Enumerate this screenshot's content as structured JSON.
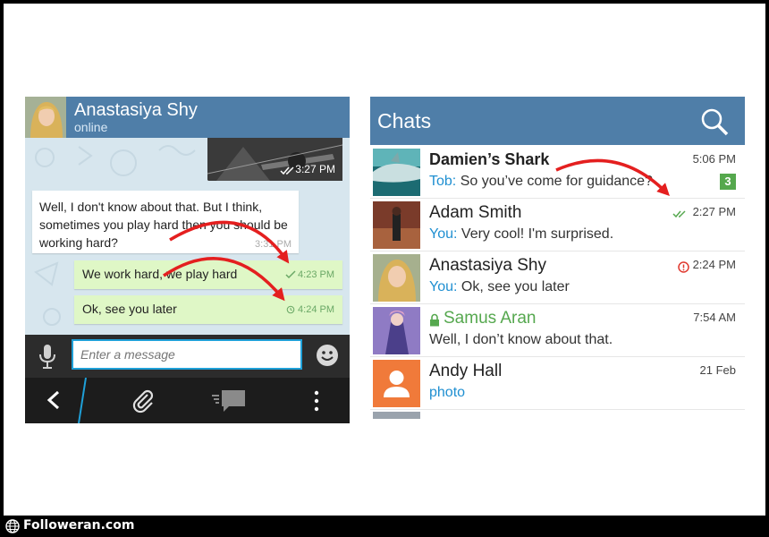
{
  "footer": {
    "brand": "Followeran.com"
  },
  "conversation": {
    "contact_name": "Anastasiya Shy",
    "contact_status": "online",
    "photo_message_time": "3:27 PM",
    "incoming_message": {
      "text": "Well, I don't know about that. But I think, sometimes you play hard then you should be working hard?",
      "time": "3:31 PM"
    },
    "outgoing_messages": [
      {
        "text": "We work hard, we play hard",
        "time": "4:23 PM",
        "status": "sent"
      },
      {
        "text": "Ok, see you later",
        "time": "4:24 PM",
        "status": "pending"
      }
    ],
    "input_placeholder": "Enter a message"
  },
  "chats": {
    "title": "Chats",
    "items": [
      {
        "name": "Damien’s Shark",
        "sender": "Tob:",
        "preview": "So you’ve come for guidance?",
        "time": "5:06 PM",
        "unread": "3"
      },
      {
        "name": "Adam Smith",
        "sender": "You:",
        "preview": "Very cool! I'm surprised.",
        "time": "2:27 PM",
        "status": "read"
      },
      {
        "name": "Anastasiya Shy",
        "sender": "You:",
        "preview": "Ok, see you later",
        "time": "2:24 PM",
        "status": "error"
      },
      {
        "name": "Samus Aran",
        "sender": "",
        "preview": "Well, I don’t know about that.",
        "time": "7:54 AM",
        "secret": true
      },
      {
        "name": "Andy Hall",
        "sender": "",
        "preview": "photo",
        "time": "21 Feb"
      }
    ]
  },
  "colors": {
    "header_blue": "#4f7ea8",
    "outgoing_bubble": "#dff7c6",
    "accent_blue": "#1f8fd1",
    "accent_green": "#55a84d",
    "arrow_red": "#e41f1f"
  }
}
